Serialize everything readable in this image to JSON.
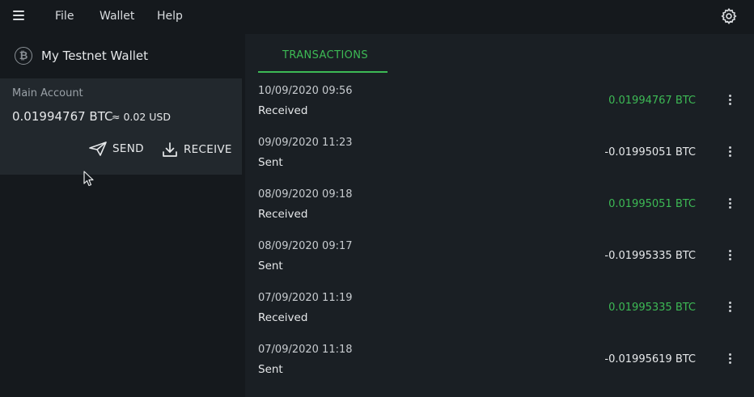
{
  "menu": {
    "items": [
      "File",
      "Wallet",
      "Help"
    ]
  },
  "sidebar": {
    "wallet_icon_glyph": "₿",
    "wallet_name": "My Testnet Wallet",
    "account": {
      "title": "Main Account",
      "balance": "0.01994767 BTC",
      "fiat": "≈ 0.02 USD",
      "send_label": "SEND",
      "receive_label": "RECEIVE"
    }
  },
  "main": {
    "tab_label": "TRANSACTIONS",
    "transactions": [
      {
        "date": "10/09/2020 09:56",
        "type": "Received",
        "amount": "0.01994767 BTC",
        "direction": "in"
      },
      {
        "date": "09/09/2020 11:23",
        "type": "Sent",
        "amount": "-0.01995051 BTC",
        "direction": "out"
      },
      {
        "date": "08/09/2020 09:18",
        "type": "Received",
        "amount": "0.01995051 BTC",
        "direction": "in"
      },
      {
        "date": "08/09/2020 09:17",
        "type": "Sent",
        "amount": "-0.01995335 BTC",
        "direction": "out"
      },
      {
        "date": "07/09/2020 11:19",
        "type": "Received",
        "amount": "0.01995335 BTC",
        "direction": "in"
      },
      {
        "date": "07/09/2020 11:18",
        "type": "Sent",
        "amount": "-0.01995619 BTC",
        "direction": "out"
      }
    ]
  },
  "colors": {
    "accent_green": "#3dba55",
    "background": "#15191d",
    "card": "#22282d",
    "panel": "#1a1f24"
  },
  "icons": [
    "menu-icon",
    "settings-icon",
    "bitcoin-icon",
    "send-icon",
    "receive-icon",
    "more-vertical-icon"
  ]
}
